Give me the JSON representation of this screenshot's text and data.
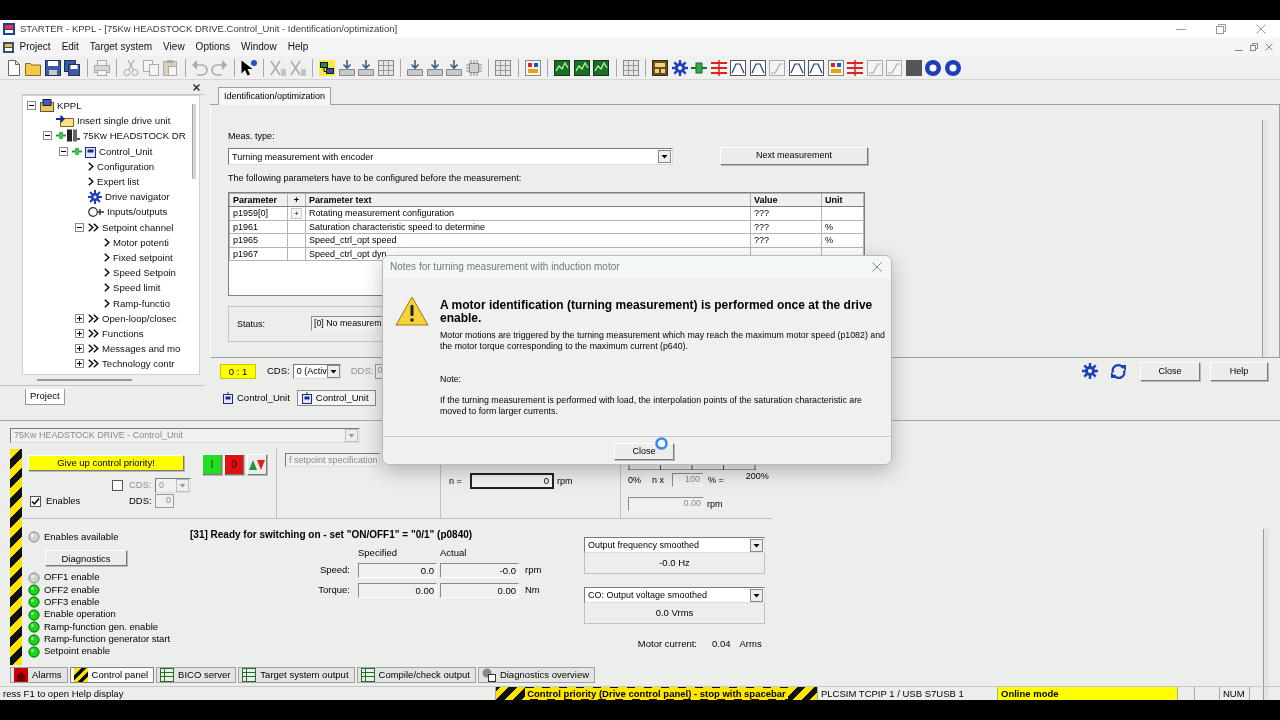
{
  "window": {
    "title": "STARTER - KPPL - [75Kw HEADSTOCK DRIVE.Control_Unit - Identification/optimization]"
  },
  "menu": [
    "Project",
    "Edit",
    "Target system",
    "View",
    "Options",
    "Window",
    "Help"
  ],
  "project_tree": {
    "items": [
      {
        "label": "KPPL",
        "kind": "project",
        "expanded": true,
        "children": [
          {
            "label": "Insert single drive unit",
            "kind": "insert"
          },
          {
            "label": "75Kw HEADSTOCK DR",
            "kind": "drive",
            "expanded": true,
            "children": [
              {
                "label": "Control_Unit",
                "kind": "control-unit",
                "expanded": true,
                "children": [
                  {
                    "label": "Configuration",
                    "kind": "chevron"
                  },
                  {
                    "label": "Expert list",
                    "kind": "chevron"
                  },
                  {
                    "label": "Drive navigator",
                    "kind": "navigator"
                  },
                  {
                    "label": "Inputs/outputs",
                    "kind": "io"
                  },
                  {
                    "label": "Setpoint channel",
                    "kind": "double-chevron",
                    "expanded": true,
                    "children": [
                      {
                        "label": "Motor potenti",
                        "kind": "chevron"
                      },
                      {
                        "label": "Fixed setpoint",
                        "kind": "chevron"
                      },
                      {
                        "label": "Speed Setpoin",
                        "kind": "chevron"
                      },
                      {
                        "label": "Speed limit",
                        "kind": "chevron"
                      },
                      {
                        "label": "Ramp-functio",
                        "kind": "chevron"
                      }
                    ]
                  },
                  {
                    "label": "Open-loop/closec",
                    "kind": "double-chevron",
                    "expanded": false
                  },
                  {
                    "label": "Functions",
                    "kind": "double-chevron",
                    "expanded": false
                  },
                  {
                    "label": "Messages and mo",
                    "kind": "double-chevron",
                    "expanded": false
                  },
                  {
                    "label": "Technology contr",
                    "kind": "double-chevron",
                    "expanded": false
                  }
                ]
              }
            ]
          }
        ]
      }
    ],
    "tabs": [
      {
        "label": "Project",
        "selected": true
      }
    ]
  },
  "workspace": {
    "tabs": [
      {
        "label": "Identification/optimization",
        "selected": true
      }
    ],
    "meas_type_label": "Meas. type:",
    "meas_type": "Turning measurement with encoder",
    "next_button": "Next measurement",
    "instruction": "The following parameters have to be configured before the measurement:",
    "table": {
      "columns": [
        "Parameter",
        "+",
        "Parameter text",
        "Value",
        "Unit"
      ],
      "rows": [
        {
          "parameter": "p1959[0]",
          "expand": "+",
          "text": "Rotating measurement configuration",
          "value": "???"
        },
        {
          "parameter": "p1961",
          "text": "Saturation characteristic speed to determine",
          "value": "???",
          "unit": "%"
        },
        {
          "parameter": "p1965",
          "text": "Speed_ctrl_opt speed",
          "value": "???",
          "unit": "%"
        },
        {
          "parameter": "p1967",
          "text": "Speed_ctrl_opt dyn"
        }
      ]
    },
    "status_label": "Status:",
    "status_value": "[0] No measurem",
    "ratio": "0 : 1",
    "cds": {
      "label": "CDS:",
      "value": "0 (Activ",
      "disabled": false
    },
    "dds": {
      "label": "DDS:",
      "value": "0",
      "disabled": true
    },
    "buttons": [
      "Close",
      "Help"
    ],
    "document_tabs": [
      {
        "label": "Control_Unit",
        "selected": false
      },
      {
        "label": "Control_Unit",
        "selected": true
      }
    ]
  },
  "control_panel": {
    "drive": {
      "value": "75Kw HEADSTOCK DRIVE - Control_Unit",
      "disabled": true
    },
    "priority_button": "Give up control priority!",
    "on_button": "I",
    "off_button": "0",
    "cds": {
      "checked": false,
      "label": "CDS:",
      "value": "0",
      "disabled": true
    },
    "enables": {
      "label": "Enables",
      "checked": true
    },
    "dds": {
      "label": "DDS:",
      "value": "0",
      "disabled": true
    },
    "setpoint_source": {
      "value": "f setpoint specification",
      "disabled": true
    },
    "speed_setpoint": {
      "label": "n =",
      "value": "0",
      "unit": "rpm"
    },
    "scale": {
      "min": "0%",
      "factor_label": "n x",
      "factor": "100",
      "equals": "% =",
      "max": "200%"
    },
    "scaled": {
      "value": "0.00",
      "unit": "rpm"
    },
    "state_text": "[31] Ready for switching on - set \"ON/OFF1\" = \"0/1\" (p0840)",
    "enables_available": {
      "label": "Enables available",
      "on": false
    },
    "diagnostics_button": "Diagnostics",
    "signals": [
      {
        "label": "OFF1 enable",
        "on": false
      },
      {
        "label": "OFF2 enable",
        "on": true
      },
      {
        "label": "OFF3 enable",
        "on": true
      },
      {
        "label": "Enable operation",
        "on": true
      },
      {
        "label": "Ramp-function gen. enable",
        "on": true
      },
      {
        "label": "Ramp-function generator start",
        "on": true
      },
      {
        "label": "Setpoint enable",
        "on": true
      }
    ],
    "readings": {
      "columns": [
        "Specified",
        "Actual"
      ],
      "rows": [
        {
          "label": "Speed:",
          "specified": "0.0",
          "actual": "-0.0",
          "unit": "rpm"
        },
        {
          "label": "Torque:",
          "specified": "0.00",
          "actual": "0.00",
          "unit": "Nm"
        }
      ]
    },
    "monitors": [
      {
        "signal": "Output frequency smoothed",
        "reading": "-0.0 Hz"
      },
      {
        "signal": "CO: Output voltage smoothed",
        "reading": "0.0 Vrms"
      }
    ],
    "motor_current": {
      "label": "Motor current:",
      "value": "0.04",
      "unit": "Arms"
    }
  },
  "bottom_tabs": [
    {
      "label": "Alarms",
      "kind": "alarm",
      "selected": false
    },
    {
      "label": "Control panel",
      "kind": "hazard",
      "selected": true
    },
    {
      "label": "BICO server",
      "kind": "table",
      "selected": false
    },
    {
      "label": "Target system output",
      "kind": "table",
      "selected": false
    },
    {
      "label": "Compile/check output",
      "kind": "table",
      "selected": false
    },
    {
      "label": "Diagnostics overview",
      "kind": "diagnostics",
      "selected": false
    }
  ],
  "status_bar": [
    {
      "kind": "text",
      "text": "ress F1 to open Help display"
    },
    {
      "kind": "hazard",
      "text": "Control priority (Drive control panel) - stop with spacebar"
    },
    {
      "kind": "text",
      "text": "PLCSIM TCPIP 1 / USB S7USB 1"
    },
    {
      "kind": "highlight",
      "text": "Online mode"
    },
    {
      "kind": "empty"
    },
    {
      "kind": "empty"
    },
    {
      "kind": "text",
      "text": "NUM"
    },
    {
      "kind": "empty"
    }
  ],
  "dialog": {
    "title": "Notes for turning measurement with induction motor",
    "heading": "A motor identification (turning measurement) is performed once at the drive enable.",
    "message": "Motor motions are triggered by the turning measurement which may reach the maximum motor speed (p1082) and the motor torque corresponding to the maximum current (p640).",
    "note_label": "Note:",
    "note": "If the turning measurement is performed with load, the interpolation points of the saturation characteristic are moved to form larger currents.",
    "button": "Close"
  }
}
